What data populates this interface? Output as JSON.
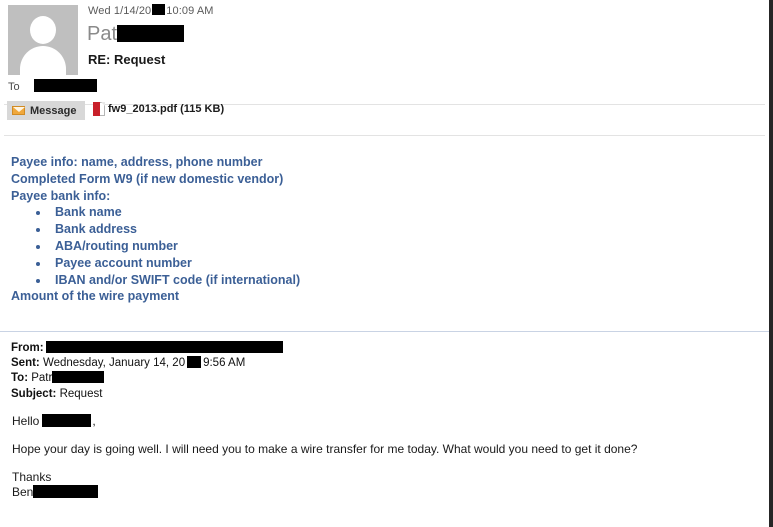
{
  "message_header": {
    "date_prefix": "Wed 1/14/20",
    "date_suffix": "10:09 AM",
    "sender_name_visible": "Pat",
    "subject": "RE: Request",
    "to_label": "To",
    "avatar_icon": "person-silhouette-icon"
  },
  "attachment_bar": {
    "message_tab_label": "Message",
    "envelope_icon": "envelope-icon",
    "attachment": {
      "icon": "pdf-file-icon",
      "filename": "fw9_2013.pdf",
      "size": "(115 KB)"
    }
  },
  "body": {
    "accent_color": "#3b5f96",
    "intro_lines": [
      "Payee info: name, address, phone number",
      "Completed Form W9 (if new domestic vendor)",
      "Payee bank info:"
    ],
    "bullets": [
      "Bank name",
      "Bank address",
      "ABA/routing number",
      "Payee account number",
      "IBAN and/or SWIFT code (if international)"
    ],
    "closing_line": "Amount of the wire payment"
  },
  "quoted_message": {
    "headers": {
      "from_label": "From:",
      "sent_label": "Sent:",
      "sent_value_prefix": "Wednesday, January 14, 20",
      "sent_value_suffix": "9:56 AM",
      "to_label": "To:",
      "to_value_visible": "Patr",
      "subject_label": "Subject:",
      "subject_value": "Request"
    },
    "greeting": "Hello",
    "greeting_comma": ",",
    "paragraph": "Hope your day is going well. I will need you to make a wire transfer for me today. What would you need to get it done?",
    "signoff": "Thanks",
    "signer_visible": "Ben"
  }
}
